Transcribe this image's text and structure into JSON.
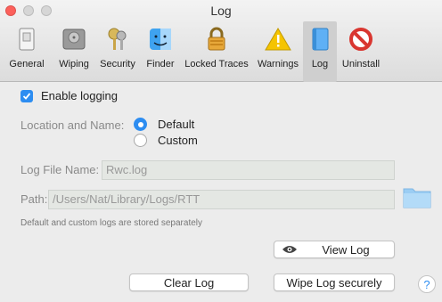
{
  "window": {
    "title": "Log"
  },
  "toolbar": {
    "items": [
      {
        "label": "General",
        "icon": "general-prefs-icon"
      },
      {
        "label": "Wiping",
        "icon": "hard-drive-icon"
      },
      {
        "label": "Security",
        "icon": "keys-icon"
      },
      {
        "label": "Finder",
        "icon": "finder-icon"
      },
      {
        "label": "Locked Traces",
        "icon": "padlock-icon"
      },
      {
        "label": "Warnings",
        "icon": "warning-icon"
      },
      {
        "label": "Log",
        "icon": "log-icon",
        "selected": true
      },
      {
        "label": "Uninstall",
        "icon": "prohibited-icon"
      }
    ]
  },
  "logging": {
    "enable_label": "Enable logging",
    "checked": true
  },
  "location": {
    "label": "Location and Name:",
    "options": [
      {
        "label": "Default",
        "selected": true
      },
      {
        "label": "Custom",
        "selected": false
      }
    ]
  },
  "log_file": {
    "label": "Log File Name:",
    "value": "Rwc.log"
  },
  "path": {
    "label": "Path:",
    "value": "/Users/Nat/Library/Logs/RTT"
  },
  "note": "Default and custom logs are stored separately",
  "buttons": {
    "view_log": "View Log",
    "clear_log": "Clear Log",
    "wipe_log": "Wipe Log securely",
    "help": "?"
  },
  "colors": {
    "accent": "#2d8df1",
    "close": "#fc605b"
  }
}
